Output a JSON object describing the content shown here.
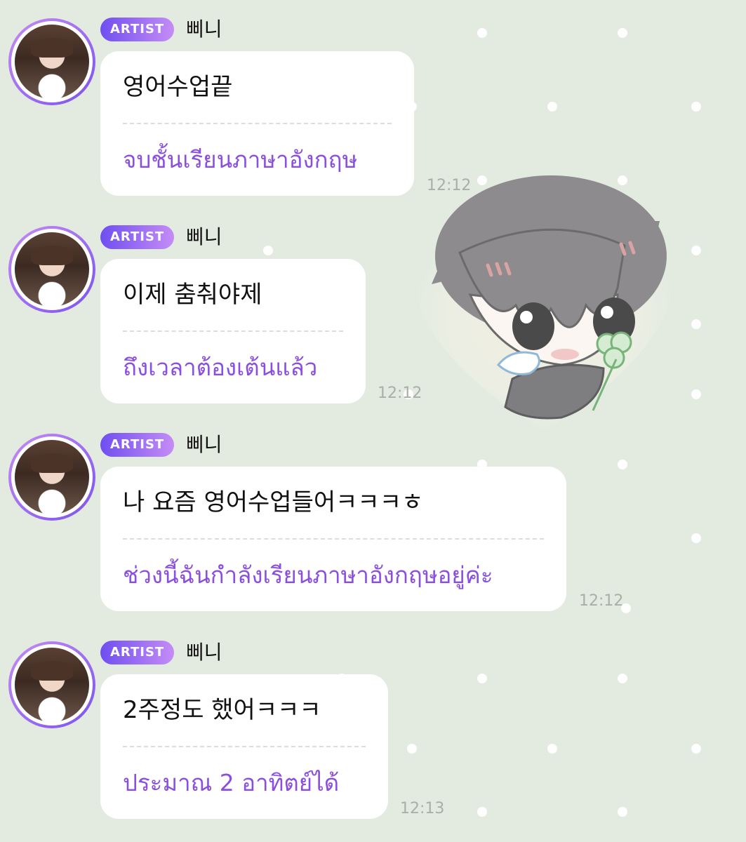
{
  "chat": {
    "messages": [
      {
        "badge": "ARTIST",
        "sender": "삐니",
        "text_ko": "영어수업끝",
        "text_th": "จบชั้นเรียนภาษาอังกฤษ",
        "time": "12:12"
      },
      {
        "badge": "ARTIST",
        "sender": "삐니",
        "text_ko": "이제 춤춰야제",
        "text_th": "ถึงเวลาต้องเต้นแล้ว",
        "time": "12:12"
      },
      {
        "badge": "ARTIST",
        "sender": "삐니",
        "text_ko": "나 요즘 영어수업들어ㅋㅋㅋㅎ",
        "text_th": "ช่วงนี้ฉันกำลังเรียนภาษาอังกฤษอยู่ค่ะ",
        "time": "12:12"
      },
      {
        "badge": "ARTIST",
        "sender": "삐니",
        "text_ko": "2주정도 했어ㅋㅋㅋ",
        "text_th": "ประมาณ 2 อาทิตย์ได้",
        "time": "12:13"
      }
    ]
  },
  "theme": {
    "background": "#e3ebe1",
    "badge_gradient": [
      "#6f4ff0",
      "#c58cf6"
    ],
    "translation_color": "#8a4fe0",
    "time_color": "#a9aea8"
  },
  "background_art": {
    "sticker": "chibi-character-with-clover-sticker"
  }
}
